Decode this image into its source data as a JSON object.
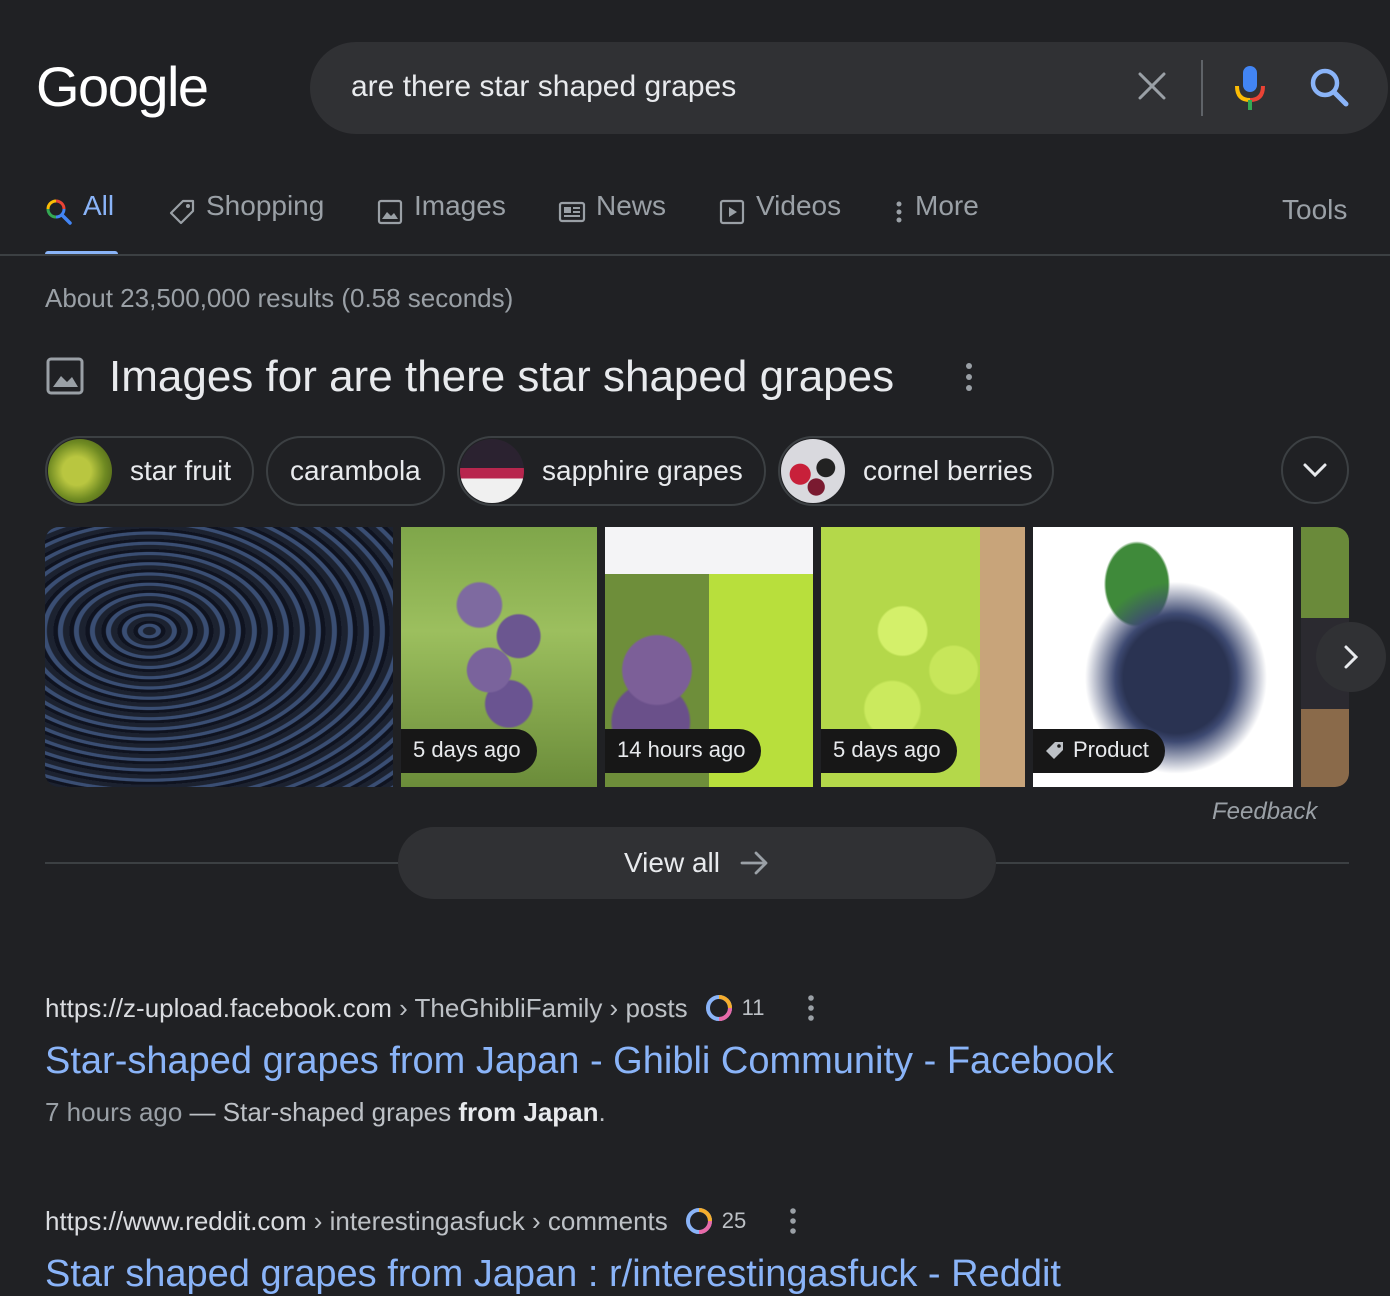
{
  "logo": "Google",
  "search": {
    "query": "are there star shaped grapes"
  },
  "tabs": [
    {
      "label": "All",
      "icon": "search-icon",
      "active": true
    },
    {
      "label": "Shopping",
      "icon": "tag-icon"
    },
    {
      "label": "Images",
      "icon": "image-icon"
    },
    {
      "label": "News",
      "icon": "newspaper-icon"
    },
    {
      "label": "Videos",
      "icon": "play-icon"
    },
    {
      "label": "More",
      "icon": "dots-vertical-icon"
    }
  ],
  "tools": "Tools",
  "stats": "About 23,500,000 results (0.58 seconds)",
  "images_section": {
    "title": "Images for are there star shaped grapes",
    "chips": [
      "star fruit",
      "carambola",
      "sapphire grapes",
      "cornel berries"
    ],
    "tiles": [
      {
        "badge": ""
      },
      {
        "badge": "5 days ago"
      },
      {
        "badge": "14 hours ago"
      },
      {
        "badge": "5 days ago"
      },
      {
        "badge": "Product"
      },
      {
        "badge": ""
      }
    ],
    "feedback": "Feedback",
    "view_all": "View all"
  },
  "results": [
    {
      "url_host": "https://z-upload.facebook.com",
      "url_path": " › TheGhibliFamily › posts",
      "count": "11",
      "title": "Star-shaped grapes from Japan - Ghibli Community - Facebook",
      "date": "7 hours ago",
      "snippet_dash": " — ",
      "snippet_plain": "Star-shaped grapes ",
      "snippet_bold": "from Japan",
      "snippet_end": "."
    },
    {
      "url_host": "https://www.reddit.com",
      "url_path": " › interestingasfuck › comments",
      "count": "25",
      "title": "Star shaped grapes from Japan : r/interestingasfuck - Reddit"
    }
  ],
  "colors": {
    "background": "#202124",
    "link": "#8ab4f8",
    "surface": "#303134"
  }
}
